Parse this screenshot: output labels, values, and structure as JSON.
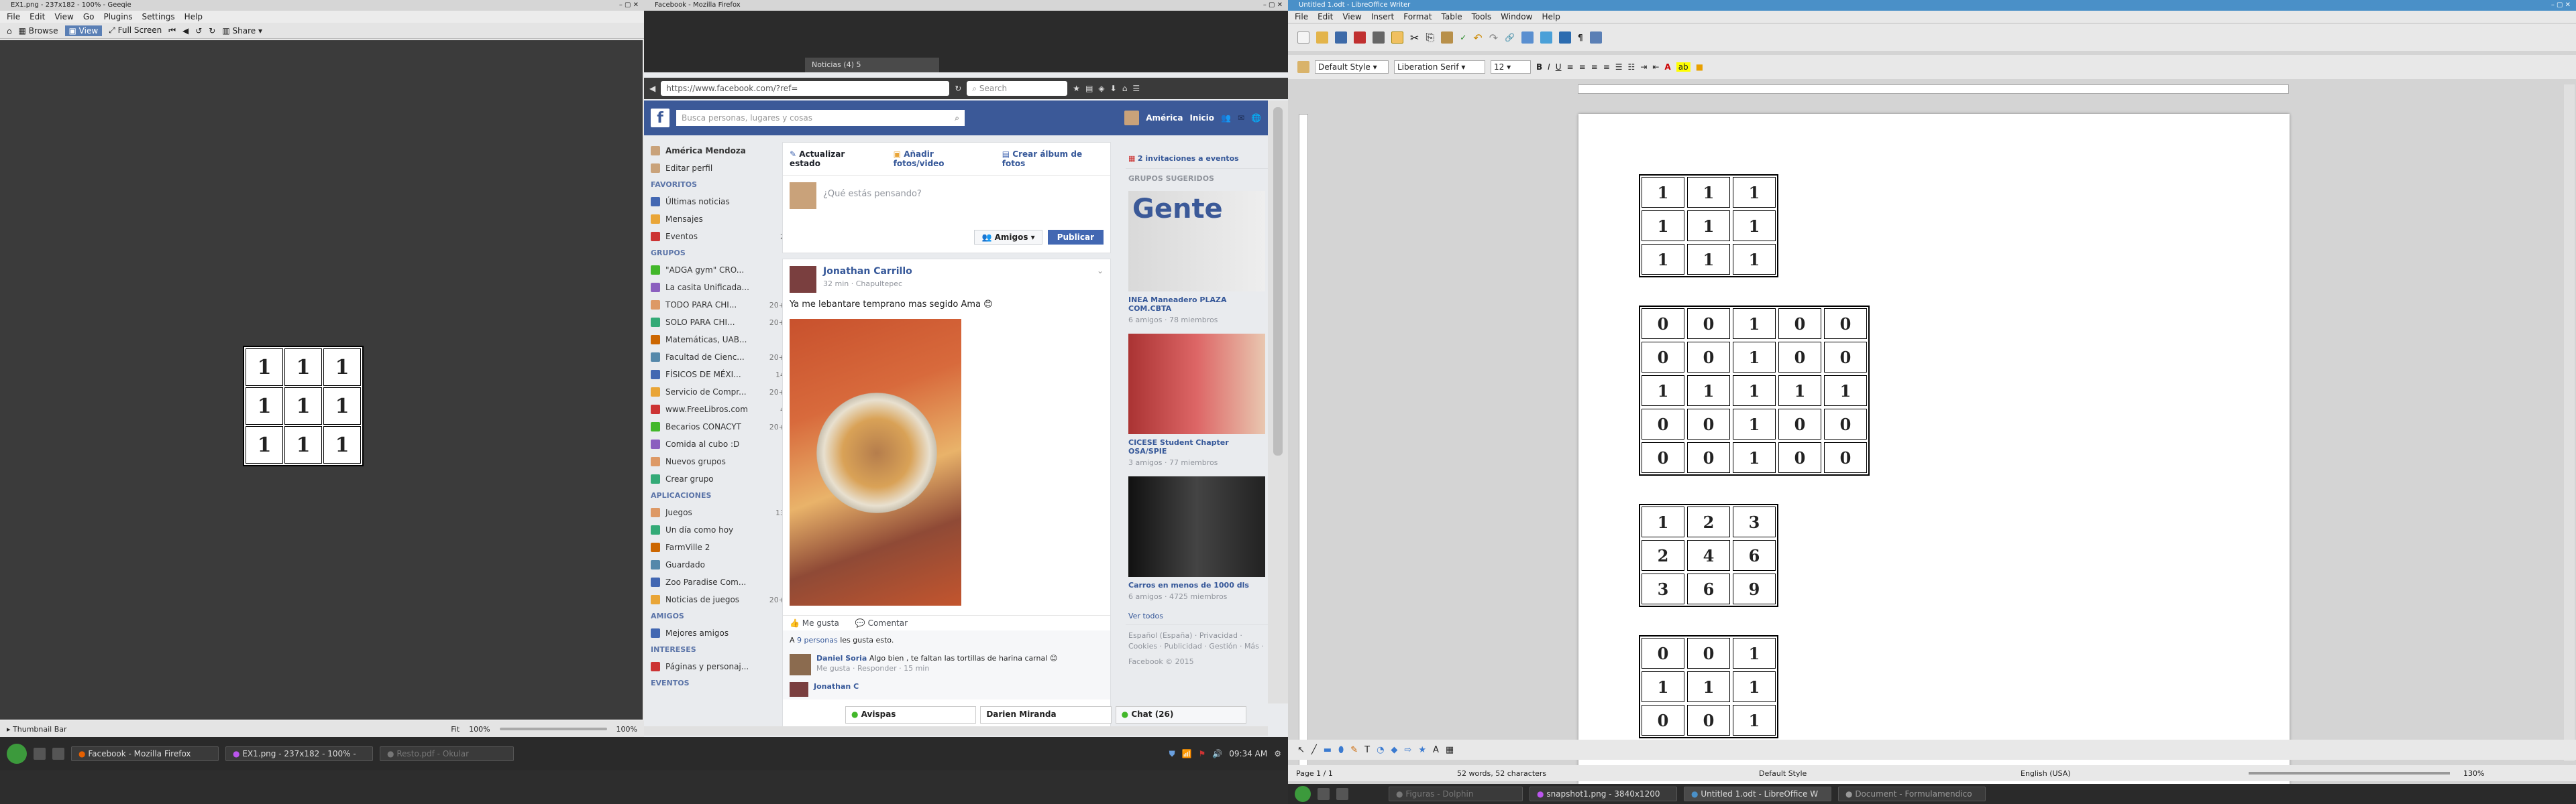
{
  "geeqie": {
    "title": "EX1.png - 237x182 - 100% - Geeqie",
    "menu": [
      "File",
      "Edit",
      "View",
      "Go",
      "Plugins",
      "Settings",
      "Help"
    ],
    "toolbar": {
      "browse": "Browse",
      "view": "View",
      "fullscreen": "Full Screen",
      "share": "Share"
    },
    "image_grid": [
      [
        "1",
        "1",
        "1"
      ],
      [
        "1",
        "1",
        "1"
      ],
      [
        "1",
        "1",
        "1"
      ]
    ],
    "status": {
      "thumbnail": "Thumbnail Bar",
      "fit": "Fit",
      "zoom1": "100%",
      "zoom2": "100%"
    }
  },
  "firefox": {
    "title": "Facebook - Mozilla Firefox",
    "tab_label": "Noticias (4) 5",
    "url": "https://www.facebook.com/?ref=",
    "search_placeholder": "Search",
    "fb": {
      "search_placeholder": "Busca personas, lugares y cosas",
      "user": "América",
      "home": "Inicio",
      "sidebar": {
        "profile_name": "América Mendoza",
        "edit_profile": "Editar perfil",
        "favorites_header": "FAVORITOS",
        "favorites": [
          {
            "label": "Últimas noticias",
            "count": ""
          },
          {
            "label": "Mensajes",
            "count": ""
          },
          {
            "label": "Eventos",
            "count": "2"
          }
        ],
        "groups_header": "GRUPOS",
        "groups": [
          {
            "label": "\"ADGA gym\" CRO...",
            "count": ""
          },
          {
            "label": "La casita Unificada...",
            "count": ""
          },
          {
            "label": "TODO PARA CHI...",
            "count": "20+"
          },
          {
            "label": "SOLO PARA CHI...",
            "count": "20+"
          },
          {
            "label": "Matemáticas, UAB...",
            "count": ""
          },
          {
            "label": "Facultad de Cienc...",
            "count": "20+"
          },
          {
            "label": "FÍSICOS DE MÉXI...",
            "count": "14"
          },
          {
            "label": "Servicio de Compr...",
            "count": "20+"
          },
          {
            "label": "www.FreeLibros.com",
            "count": "4"
          },
          {
            "label": "Becarios CONACYT",
            "count": "20+"
          },
          {
            "label": "Comida al cubo :D",
            "count": ""
          },
          {
            "label": "Nuevos grupos",
            "count": ""
          },
          {
            "label": "Crear grupo",
            "count": ""
          }
        ],
        "apps_header": "APLICACIONES",
        "apps": [
          {
            "label": "Juegos",
            "count": "13"
          },
          {
            "label": "Un día como hoy",
            "count": ""
          },
          {
            "label": "FarmVille 2",
            "count": ""
          },
          {
            "label": "Guardado",
            "count": ""
          },
          {
            "label": "Zoo Paradise Com...",
            "count": ""
          },
          {
            "label": "Noticias de juegos",
            "count": "20+"
          }
        ],
        "friends_header": "AMIGOS",
        "friends": [
          {
            "label": "Mejores amigos",
            "count": ""
          }
        ],
        "interests_header": "INTERESES",
        "interests": [
          {
            "label": "Páginas y personaj...",
            "count": ""
          }
        ],
        "events_header": "EVENTOS"
      },
      "composer": {
        "update": "Actualizar estado",
        "add_photo": "Añadir fotos/video",
        "album": "Crear álbum de fotos",
        "placeholder": "¿Qué estás pensando?",
        "audience": "Amigos",
        "publish": "Publicar"
      },
      "post": {
        "author": "Jonathan Carrillo",
        "meta": "32 min · Chapultepec",
        "text": "Ya me lebantare temprano mas segido Ama 😊",
        "like": "Me gusta",
        "comment": "Comentar",
        "likes_prefix": "A",
        "likes_link": "9 personas",
        "likes_suffix": "les gusta esto.",
        "comment_author": "Daniel Soria",
        "comment_text": "Algo bien , te faltan las tortillas de harina carnal 😊",
        "comment_actions": "Me gusta · Responder · 15 min",
        "comment2_author": "Jonathan C"
      },
      "right": {
        "invites": "2 invitaciones a eventos",
        "suggested": "GRUPOS SUGERIDOS",
        "groups": [
          {
            "banner": "Gente",
            "name": "INEA Maneadero PLAZA COM.CBTA",
            "meta": "6 amigos · 78 miembros"
          },
          {
            "banner": "",
            "name": "CICESE Student Chapter OSA/SPIE",
            "meta": "3 amigos · 77 miembros"
          },
          {
            "banner": "",
            "name": "Carros en menos de 1000 dls",
            "meta": "6 amigos · 4725 miembros"
          }
        ],
        "see_all": "Ver todos",
        "footer": "Español (España) · Privacidad · Cookies · Publicidad · Gestión · Más ·",
        "copyright": "Facebook © 2015"
      },
      "chat": {
        "item1": "Avispas",
        "item2": "Darien Miranda",
        "chat": "Chat (26)"
      }
    }
  },
  "writer": {
    "title": "Untitled 1.odt - LibreOffice Writer",
    "menu": [
      "File",
      "Edit",
      "View",
      "Insert",
      "Format",
      "Table",
      "Tools",
      "Window",
      "Help"
    ],
    "style": "Default Style",
    "font": "Liberation Serif",
    "size": "12",
    "tables": [
      [
        [
          "1",
          "1",
          "1"
        ],
        [
          "1",
          "1",
          "1"
        ],
        [
          "1",
          "1",
          "1"
        ]
      ],
      [
        [
          "0",
          "0",
          "1",
          "0",
          "0"
        ],
        [
          "0",
          "0",
          "1",
          "0",
          "0"
        ],
        [
          "1",
          "1",
          "1",
          "1",
          "1"
        ],
        [
          "0",
          "0",
          "1",
          "0",
          "0"
        ],
        [
          "0",
          "0",
          "1",
          "0",
          "0"
        ]
      ],
      [
        [
          "1",
          "2",
          "3"
        ],
        [
          "2",
          "4",
          "6"
        ],
        [
          "3",
          "6",
          "9"
        ]
      ],
      [
        [
          "0",
          "0",
          "1"
        ],
        [
          "1",
          "1",
          "1"
        ],
        [
          "0",
          "0",
          "1"
        ]
      ]
    ],
    "status": {
      "page": "Page 1 / 1",
      "words": "52 words, 52 characters",
      "style": "Default Style",
      "lang": "English (USA)",
      "zoom": "130%"
    }
  },
  "taskbar_left": {
    "items": [
      "Facebook - Mozilla Firefox",
      "EX1.png - 237x182 - 100% -",
      "Resto.pdf - Okular"
    ],
    "time": "09:34 AM"
  },
  "taskbar_right": {
    "items": [
      "Figuras - Dolphin",
      "snapshot1.png - 3840x1200",
      "Untitled 1.odt - LibreOffice W",
      "Document - Formulamendico"
    ]
  },
  "colors": {
    "fb_blue": "#3b5998",
    "lo_title": "#4a90c8",
    "gq_bg": "#3b3b3b"
  }
}
